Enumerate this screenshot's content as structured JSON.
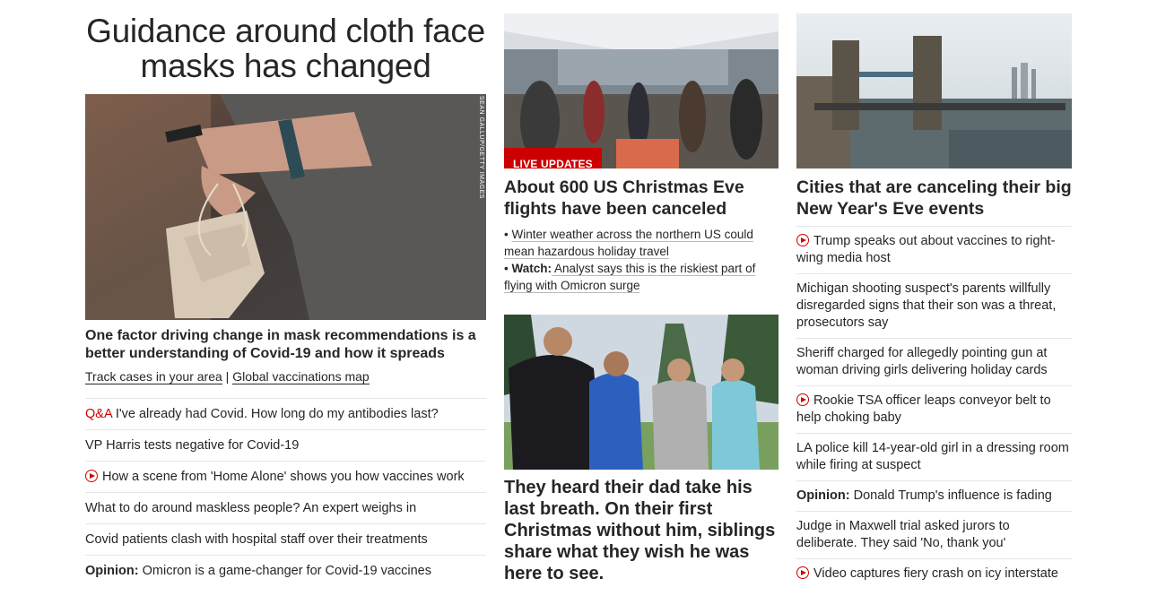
{
  "col1": {
    "headline": "Guidance around cloth face masks has changed",
    "image_credit": "SEAN GALLUP/GETTY IMAGES",
    "summary": "One factor driving change in mask recommendations is a better understanding of Covid-19 and how it spreads",
    "link_track": "Track cases in your area",
    "link_sep": " | ",
    "link_vax": "Global vaccinations map",
    "items": [
      {
        "prefix": "Q&A",
        "text": " I've already had Covid. How long do my antibodies last?"
      },
      {
        "text": "VP Harris tests negative for Covid-19"
      },
      {
        "video": true,
        "text": "How a scene from 'Home Alone' shows you how vaccines work"
      },
      {
        "text": "What to do around maskless people? An expert weighs in"
      },
      {
        "text": "Covid patients clash with hospital staff over their treatments"
      },
      {
        "opinion": "Opinion:",
        "text": " Omicron is a game-changer for Covid-19 vaccines"
      }
    ]
  },
  "col2": {
    "live_badge": "LIVE UPDATES",
    "headline1": "About 600 US Christmas Eve flights have been canceled",
    "bullet1": "Winter weather across the northern US could mean hazardous holiday travel",
    "bullet2_label": "Watch:",
    "bullet2": " Analyst says this is the riskiest part of flying with Omicron surge",
    "headline2": "They heard their dad take his last breath. On their first Christmas without him, siblings share what they wish he was here to see."
  },
  "col3": {
    "headline": "Cities that are canceling their big New Year's Eve events",
    "items": [
      {
        "video": true,
        "text": "Trump speaks out about vaccines to right-wing media host"
      },
      {
        "text": "Michigan shooting suspect's parents willfully disregarded signs that their son was a threat, prosecutors say"
      },
      {
        "text": "Sheriff charged for allegedly pointing gun at woman driving girls delivering holiday cards"
      },
      {
        "video": true,
        "text": "Rookie TSA officer leaps conveyor belt to help choking baby"
      },
      {
        "text": "LA police kill 14-year-old girl in a dressing room while firing at suspect"
      },
      {
        "opinion": "Opinion:",
        "text": " Donald Trump's influence is fading"
      },
      {
        "text": "Judge in Maxwell trial asked jurors to deliberate. They said 'No, thank you'"
      },
      {
        "video": true,
        "text": "Video captures fiery crash on icy interstate"
      }
    ]
  },
  "colors": {
    "accent": "#cc0000",
    "text": "#262626",
    "divider": "#e6e6e6"
  }
}
